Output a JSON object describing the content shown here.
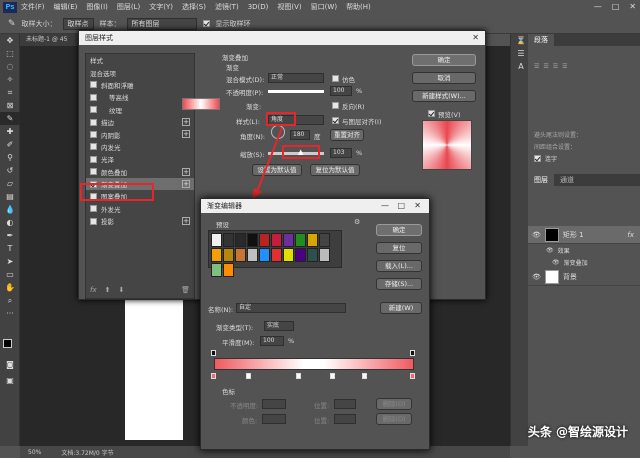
{
  "menu": [
    "文件(F)",
    "编辑(E)",
    "图像(I)",
    "图层(L)",
    "文字(Y)",
    "选择(S)",
    "滤镜(T)",
    "3D(D)",
    "视图(V)",
    "窗口(W)",
    "帮助(H)"
  ],
  "options": {
    "size_label": "取样大小：",
    "size_value": "取样点",
    "sample_label": "样本：",
    "sample_value": "所有图层",
    "ring_label": "显示取样环"
  },
  "doc_tab": "未标题-1 @ 45",
  "status": {
    "zoom": "50%",
    "doc": "文档:3.72M/0 字节"
  },
  "right_panel": {
    "tab1": "段落",
    "lock_label": "避头尾法则设置：",
    "spacing_label": "间距组合设置：",
    "hyphen": "连字",
    "layers_tab": "图层",
    "channels_tab": "通道",
    "layer1": "矩形 1",
    "effects": "效果",
    "effect_item": "渐变叠加",
    "layer_bg": "背景",
    "fx": "fx"
  },
  "layer_style": {
    "title": "图层样式",
    "list": [
      {
        "label": "样式",
        "cb": false,
        "plus": false
      },
      {
        "label": "混合选项",
        "cb": false,
        "plus": false
      },
      {
        "label": "斜面和浮雕",
        "cb": true,
        "plus": false
      },
      {
        "label": "等高线",
        "cb": true,
        "plus": false
      },
      {
        "label": "纹理",
        "cb": true,
        "plus": false
      },
      {
        "label": "描边",
        "cb": true,
        "plus": true
      },
      {
        "label": "内阴影",
        "cb": true,
        "plus": true
      },
      {
        "label": "内发光",
        "cb": true,
        "plus": false
      },
      {
        "label": "光泽",
        "cb": true,
        "plus": false
      },
      {
        "label": "颜色叠加",
        "cb": true,
        "plus": true
      },
      {
        "label": "渐变叠加",
        "cb": true,
        "plus": true,
        "on": true,
        "sel": true
      },
      {
        "label": "图案叠加",
        "cb": true,
        "plus": false
      },
      {
        "label": "外发光",
        "cb": true,
        "plus": false
      },
      {
        "label": "投影",
        "cb": true,
        "plus": true
      }
    ],
    "section": "渐变叠加",
    "sub": "渐变",
    "blend_label": "混合模式(D):",
    "blend_value": "正常",
    "dither": "仿色",
    "opacity_label": "不透明度(P):",
    "opacity_value": "100",
    "pct": "%",
    "gradient_label": "渐变:",
    "reverse": "反向(R)",
    "style_label": "样式(L):",
    "style_value": "角度",
    "align": "与图层对齐(I)",
    "angle_label": "角度(N):",
    "angle_value": "180",
    "deg": "度",
    "reset_align": "重置对齐",
    "scale_label": "缩放(S):",
    "scale_value": "103",
    "set_default": "设置为默认值",
    "reset_default": "复位为默认值",
    "ok": "确定",
    "cancel": "取消",
    "new_style": "新建样式(W)...",
    "preview": "预览(V)"
  },
  "gradient_editor": {
    "title": "渐变编辑器",
    "presets": "预设",
    "ok": "确定",
    "reset": "复位",
    "load": "载入(L)...",
    "save": "存储(S)...",
    "name_label": "名称(N):",
    "name_value": "自定",
    "new": "新建(W)",
    "type_label": "渐变类型(T):",
    "type_value": "实底",
    "smooth_label": "平滑度(M):",
    "smooth_value": "100",
    "pct": "%",
    "stops": "色标",
    "op_label": "不透明度:",
    "loc_label": "位置:",
    "del": "删除(D)",
    "color_label": "颜色:",
    "color_loc": "位置:",
    "del2": "删除(D)",
    "swatches": [
      "#f0f0f0",
      "#333",
      "#2a2a2a",
      "#111",
      "#b22",
      "#c41e3a",
      "#6b2fa0",
      "#228b22",
      "#d7a600",
      "#444",
      "#f5a000",
      "#b8860b",
      "#c87533",
      "#c0c0c0",
      "#1e90ff",
      "#e03030",
      "#e0e000",
      "#4b0082",
      "#2f4f4f",
      "#bbb",
      "#7fbf7f",
      "#ff8c00"
    ]
  },
  "watermark": "头条 @智绘源设计"
}
